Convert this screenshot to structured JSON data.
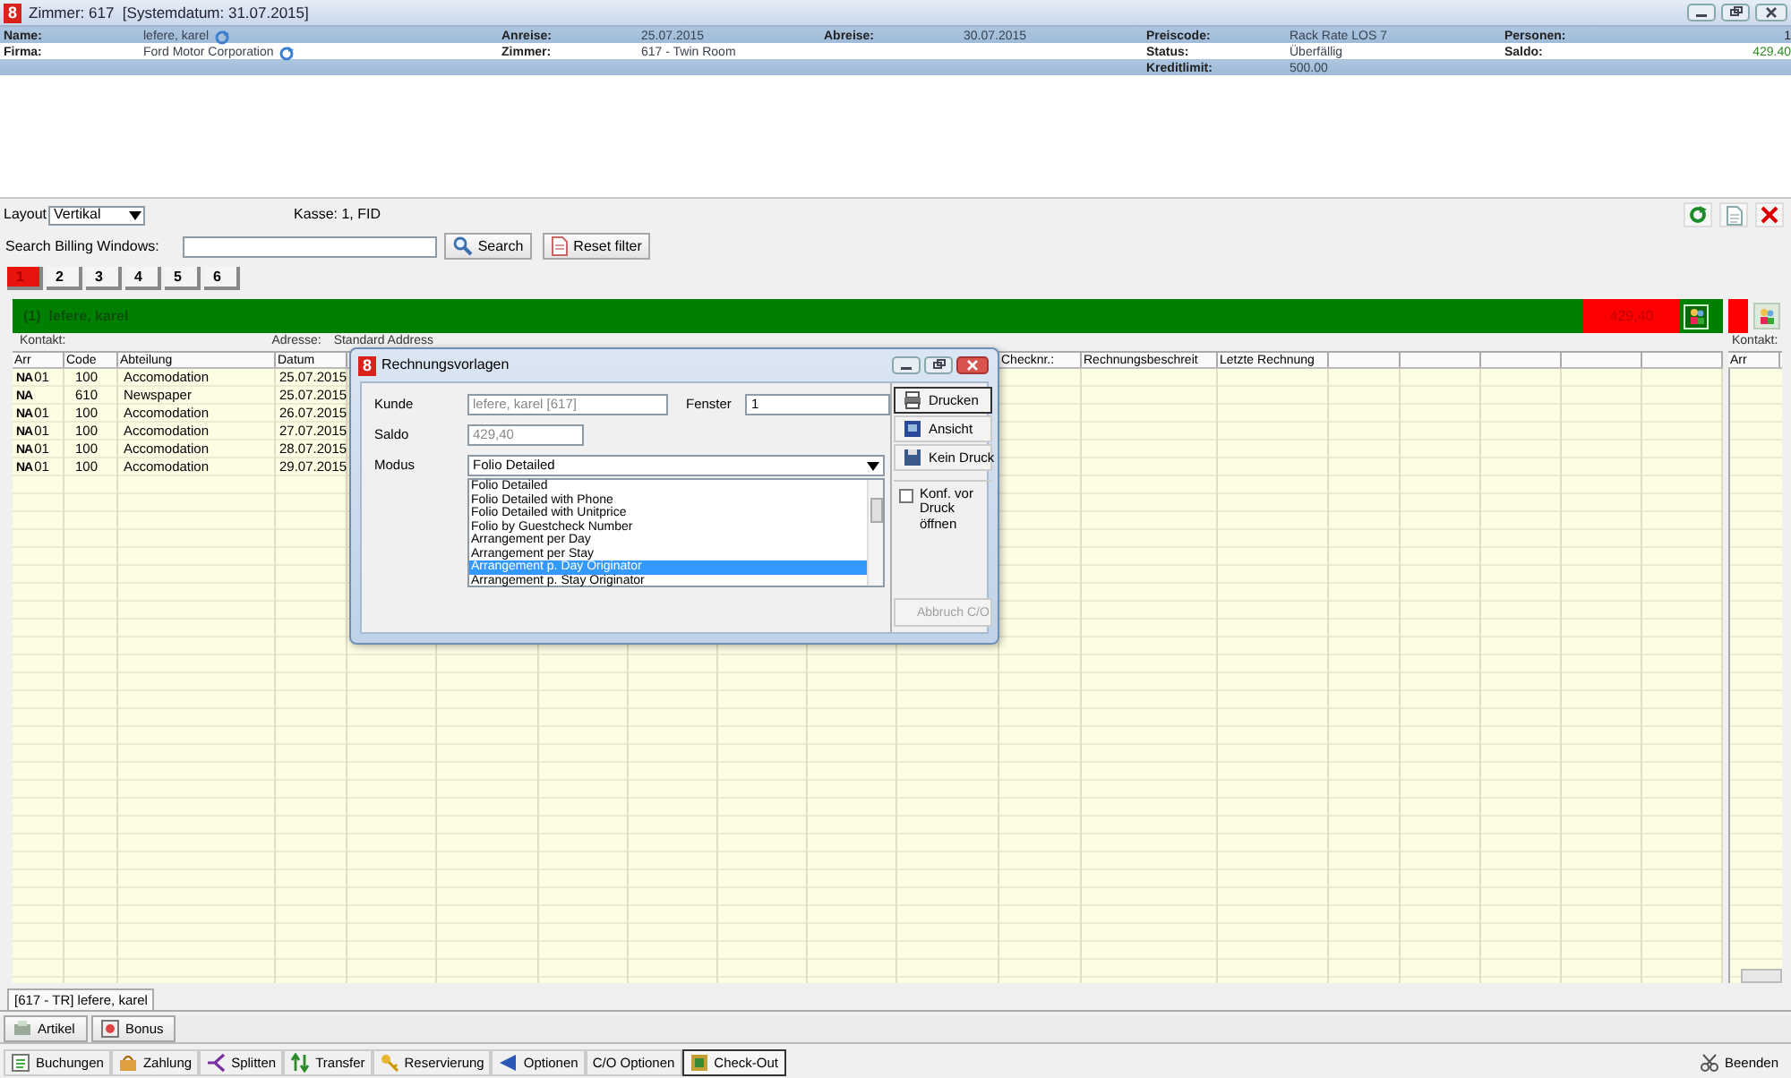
{
  "window": {
    "logo": "8",
    "title": "Zimmer: 617  [Systemdatum: 31.07.2015]"
  },
  "info": {
    "columns": [
      [
        {
          "label": "Name:",
          "value": "lefere, karel",
          "kind": "refresh"
        },
        {
          "label": "Firma:",
          "value": "Ford Motor Corporation",
          "kind": "refresh"
        }
      ],
      [
        {
          "label": "Anreise:",
          "value": "25.07.2015",
          "kind": "plain"
        },
        {
          "label": "Zimmer:",
          "value": "617 - Twin Room",
          "kind": "plain"
        }
      ],
      [
        {
          "label": "Abreise:",
          "value": "30.07.2015",
          "kind": "plain"
        }
      ],
      [
        {
          "label": "Preiscode:",
          "value": "Rack Rate LOS 7",
          "kind": "plain"
        },
        {
          "label": "Status:",
          "value": "Überfällig",
          "kind": "plain"
        },
        {
          "label": "Kreditlimit:",
          "value": "500.00",
          "kind": "plain"
        }
      ],
      [
        {
          "label": "Personen:",
          "value": "1",
          "kind": "number"
        },
        {
          "label": "Saldo:",
          "value": "429.40",
          "kind": "amount"
        }
      ]
    ]
  },
  "toolbar": {
    "layout_label": "Layout",
    "layout_value": "Vertikal",
    "register": "Kasse: 1, FID",
    "search_label": "Search Billing Windows:",
    "search_button": "Search",
    "reset_button": "Reset filter"
  },
  "window_tabs": [
    {
      "label": "1",
      "selected": true
    },
    {
      "label": "2",
      "selected": false
    },
    {
      "label": "3",
      "selected": false
    },
    {
      "label": "4",
      "selected": false
    },
    {
      "label": "5",
      "selected": false
    },
    {
      "label": "6",
      "selected": false
    }
  ],
  "folio": {
    "title": "(1)  lefere, karel",
    "amount": "429,40",
    "contact_label": "Kontakt:",
    "address_label": "Adresse:",
    "address": "Standard Address",
    "columns": [
      "Arr",
      "Code",
      "Abteilung",
      "Datum",
      "Checknr.:",
      "Rechnungsbeschreit",
      "Letzte Rechnung"
    ],
    "rows": [
      {
        "flag": "NA",
        "arr": "01",
        "code": "100",
        "department": "Accomodation",
        "date": "25.07.2015"
      },
      {
        "flag": "NA",
        "code": "610",
        "department": "Newspaper",
        "date": "25.07.2015"
      },
      {
        "flag": "NA",
        "arr": "01",
        "code": "100",
        "department": "Accomodation",
        "date": "26.07.2015"
      },
      {
        "flag": "NA",
        "arr": "01",
        "code": "100",
        "department": "Accomodation",
        "date": "27.07.2015"
      },
      {
        "flag": "NA",
        "arr": "01",
        "code": "100",
        "department": "Accomodation",
        "date": "28.07.2015"
      },
      {
        "flag": "NA",
        "arr": "01",
        "code": "100",
        "department": "Accomodation",
        "date": "29.07.2015"
      }
    ],
    "side_contact_label": "Kontakt:",
    "side_column": "Arr"
  },
  "guest_tab": "[617 - TR] lefere, karel",
  "item_buttons": [
    "Artikel",
    "Bonus"
  ],
  "actions": [
    {
      "label": "Buchungen",
      "selected": false
    },
    {
      "label": "Zahlung",
      "selected": false
    },
    {
      "label": "Splitten",
      "selected": false
    },
    {
      "label": "Transfer",
      "selected": false
    },
    {
      "label": "Reservierung",
      "selected": false
    },
    {
      "label": "Optionen",
      "selected": false
    },
    {
      "label": "C/O Optionen",
      "selected": false
    },
    {
      "label": "Check-Out",
      "selected": true
    }
  ],
  "exit_button": "Beenden",
  "dialog": {
    "logo": "8",
    "title": "Rechnungsvorlagen",
    "customer_label": "Kunde",
    "customer": "lefere, karel [617]",
    "window_label": "Fenster",
    "window": "1",
    "balance_label": "Saldo",
    "balance": "429,40",
    "mode_label": "Modus",
    "mode": "Folio Detailed",
    "options": [
      {
        "label": "Folio Detailed",
        "selected": false
      },
      {
        "label": "Folio Detailed with Phone",
        "selected": false
      },
      {
        "label": "Folio Detailed with Unitprice",
        "selected": false
      },
      {
        "label": "Folio by Guestcheck Number",
        "selected": false
      },
      {
        "label": "Arrangement per Day",
        "selected": false
      },
      {
        "label": "Arrangement per Stay",
        "selected": false
      },
      {
        "label": "Arrangement p. Day Originator",
        "selected": true
      },
      {
        "label": "Arrangement p. Stay Originator",
        "selected": false
      }
    ],
    "buttons": [
      "Drucken",
      "Ansicht",
      "Kein Druck"
    ],
    "open_config": {
      "label": "Konf. vor Druck öffnen",
      "checked": false
    },
    "cancel": {
      "label": "Abbruch C/O",
      "disabled": true
    }
  }
}
